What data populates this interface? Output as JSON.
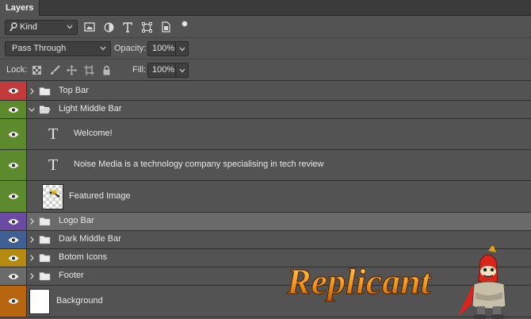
{
  "panel": {
    "title": "Layers"
  },
  "filter": {
    "kind_label": "Kind",
    "icons": [
      "image-filter-icon",
      "adjustment-filter-icon",
      "type-filter-icon",
      "shape-filter-icon",
      "smart-object-filter-icon",
      "filter-toggle-icon"
    ]
  },
  "blend": {
    "mode": "Pass Through",
    "opacity_label": "Opacity:",
    "opacity": "100%"
  },
  "lock": {
    "label": "Lock:",
    "fill_label": "Fill:",
    "fill": "100%",
    "icons": [
      "lock-transparent-pixels-icon",
      "lock-image-pixels-icon",
      "lock-position-icon",
      "lock-artboard-icon",
      "lock-all-icon"
    ]
  },
  "layers": [
    {
      "name": "Top Bar",
      "type": "group",
      "color": "#c33a3a",
      "expanded": false,
      "selected": false
    },
    {
      "name": "Light Middle Bar",
      "type": "group",
      "color": "#5e8a2e",
      "expanded": true,
      "selected": false
    },
    {
      "name": "Welcome!",
      "type": "text",
      "color": "#5e8a2e",
      "selected": false
    },
    {
      "name": "Noise Media is a technology company specialising in tech review",
      "type": "text",
      "color": "#5e8a2e",
      "selected": false
    },
    {
      "name": "Featured Image",
      "type": "image",
      "color": "#5e8a2e",
      "selected": false
    },
    {
      "name": "Logo Bar",
      "type": "group",
      "color": "#6a4aa3",
      "expanded": false,
      "selected": true
    },
    {
      "name": "Dark Middle Bar",
      "type": "group",
      "color": "#3f5f95",
      "expanded": false,
      "selected": false
    },
    {
      "name": "Botom Icons",
      "type": "group",
      "color": "#b58a10",
      "expanded": false,
      "selected": false
    },
    {
      "name": "Footer",
      "type": "group",
      "color": "#6b6b6b",
      "expanded": false,
      "selected": false
    },
    {
      "name": "Background",
      "type": "background",
      "color": "#b7650f",
      "selected": false
    }
  ],
  "watermark": {
    "text": "Replicant"
  }
}
